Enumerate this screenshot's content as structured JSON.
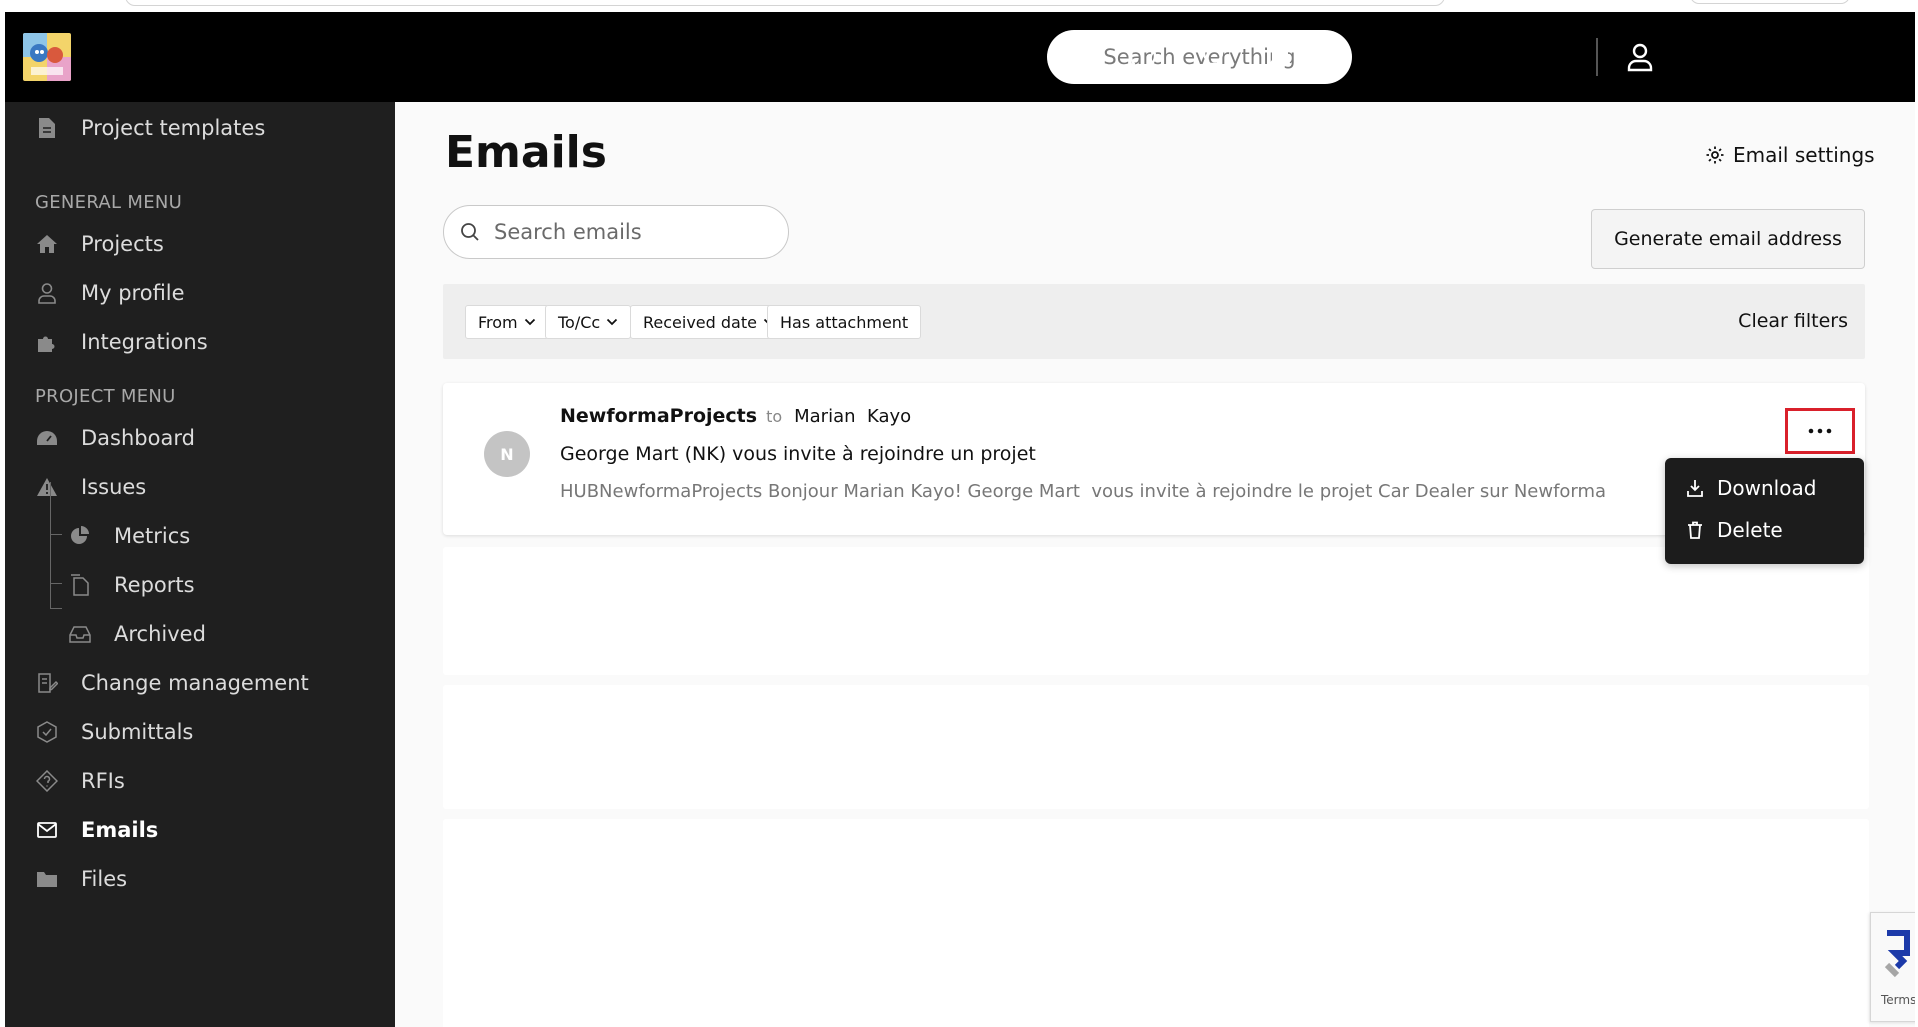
{
  "header": {
    "search_placeholder": "Search everything",
    "icons": [
      "chat-icon",
      "lightbulb-icon",
      "bell-icon",
      "user-icon"
    ]
  },
  "sidebar": {
    "top_item": "Project templates",
    "general_menu_label": "GENERAL MENU",
    "general_items": [
      "Projects",
      "My profile",
      "Integrations"
    ],
    "project_menu_label": "PROJECT MENU",
    "project_items": {
      "dashboard": "Dashboard",
      "issues": "Issues",
      "metrics": "Metrics",
      "reports": "Reports",
      "archived": "Archived",
      "change_management": "Change management",
      "submittals": "Submittals",
      "rfis": "RFIs",
      "emails": "Emails",
      "files": "Files"
    }
  },
  "main": {
    "title": "Emails",
    "email_settings_label": "Email settings",
    "search_placeholder": "Search emails",
    "generate_button": "Generate email address",
    "filters": [
      "From",
      "To/Cc",
      "Received date",
      "Has attachment"
    ],
    "clear_filters": "Clear filters",
    "email": {
      "avatar_initial": "N",
      "sender": "NewformaProjects",
      "to_word": "to",
      "recipient": "Marian  Kayo",
      "subject": "George Mart (NK) vous invite à rejoindre un projet",
      "preview": "HUBNewformaProjects Bonjour Marian Kayo! George Mart  vous invite à rejoindre le projet Car Dealer sur Newforma"
    },
    "menu": {
      "download": "Download",
      "delete": "Delete"
    }
  },
  "recaptcha": {
    "terms": "Terms"
  },
  "colors": {
    "header_bg": "#000000",
    "sidebar_bg": "#1f1f1f",
    "highlight_border": "#d9202b",
    "menu_bg": "#1c1c1c"
  }
}
